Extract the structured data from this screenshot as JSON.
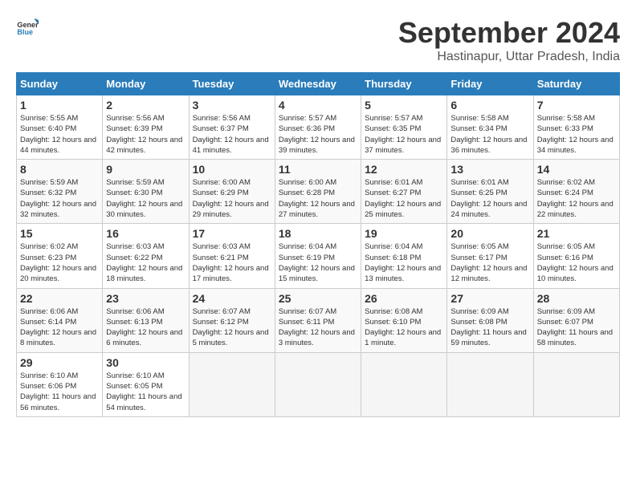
{
  "header": {
    "logo_general": "General",
    "logo_blue": "Blue",
    "month_title": "September 2024",
    "location": "Hastinapur, Uttar Pradesh, India"
  },
  "weekdays": [
    "Sunday",
    "Monday",
    "Tuesday",
    "Wednesday",
    "Thursday",
    "Friday",
    "Saturday"
  ],
  "weeks": [
    [
      {
        "day": "1",
        "sunrise": "5:55 AM",
        "sunset": "6:40 PM",
        "daylight": "12 hours and 44 minutes."
      },
      {
        "day": "2",
        "sunrise": "5:56 AM",
        "sunset": "6:39 PM",
        "daylight": "12 hours and 42 minutes."
      },
      {
        "day": "3",
        "sunrise": "5:56 AM",
        "sunset": "6:37 PM",
        "daylight": "12 hours and 41 minutes."
      },
      {
        "day": "4",
        "sunrise": "5:57 AM",
        "sunset": "6:36 PM",
        "daylight": "12 hours and 39 minutes."
      },
      {
        "day": "5",
        "sunrise": "5:57 AM",
        "sunset": "6:35 PM",
        "daylight": "12 hours and 37 minutes."
      },
      {
        "day": "6",
        "sunrise": "5:58 AM",
        "sunset": "6:34 PM",
        "daylight": "12 hours and 36 minutes."
      },
      {
        "day": "7",
        "sunrise": "5:58 AM",
        "sunset": "6:33 PM",
        "daylight": "12 hours and 34 minutes."
      }
    ],
    [
      {
        "day": "8",
        "sunrise": "5:59 AM",
        "sunset": "6:32 PM",
        "daylight": "12 hours and 32 minutes."
      },
      {
        "day": "9",
        "sunrise": "5:59 AM",
        "sunset": "6:30 PM",
        "daylight": "12 hours and 30 minutes."
      },
      {
        "day": "10",
        "sunrise": "6:00 AM",
        "sunset": "6:29 PM",
        "daylight": "12 hours and 29 minutes."
      },
      {
        "day": "11",
        "sunrise": "6:00 AM",
        "sunset": "6:28 PM",
        "daylight": "12 hours and 27 minutes."
      },
      {
        "day": "12",
        "sunrise": "6:01 AM",
        "sunset": "6:27 PM",
        "daylight": "12 hours and 25 minutes."
      },
      {
        "day": "13",
        "sunrise": "6:01 AM",
        "sunset": "6:25 PM",
        "daylight": "12 hours and 24 minutes."
      },
      {
        "day": "14",
        "sunrise": "6:02 AM",
        "sunset": "6:24 PM",
        "daylight": "12 hours and 22 minutes."
      }
    ],
    [
      {
        "day": "15",
        "sunrise": "6:02 AM",
        "sunset": "6:23 PM",
        "daylight": "12 hours and 20 minutes."
      },
      {
        "day": "16",
        "sunrise": "6:03 AM",
        "sunset": "6:22 PM",
        "daylight": "12 hours and 18 minutes."
      },
      {
        "day": "17",
        "sunrise": "6:03 AM",
        "sunset": "6:21 PM",
        "daylight": "12 hours and 17 minutes."
      },
      {
        "day": "18",
        "sunrise": "6:04 AM",
        "sunset": "6:19 PM",
        "daylight": "12 hours and 15 minutes."
      },
      {
        "day": "19",
        "sunrise": "6:04 AM",
        "sunset": "6:18 PM",
        "daylight": "12 hours and 13 minutes."
      },
      {
        "day": "20",
        "sunrise": "6:05 AM",
        "sunset": "6:17 PM",
        "daylight": "12 hours and 12 minutes."
      },
      {
        "day": "21",
        "sunrise": "6:05 AM",
        "sunset": "6:16 PM",
        "daylight": "12 hours and 10 minutes."
      }
    ],
    [
      {
        "day": "22",
        "sunrise": "6:06 AM",
        "sunset": "6:14 PM",
        "daylight": "12 hours and 8 minutes."
      },
      {
        "day": "23",
        "sunrise": "6:06 AM",
        "sunset": "6:13 PM",
        "daylight": "12 hours and 6 minutes."
      },
      {
        "day": "24",
        "sunrise": "6:07 AM",
        "sunset": "6:12 PM",
        "daylight": "12 hours and 5 minutes."
      },
      {
        "day": "25",
        "sunrise": "6:07 AM",
        "sunset": "6:11 PM",
        "daylight": "12 hours and 3 minutes."
      },
      {
        "day": "26",
        "sunrise": "6:08 AM",
        "sunset": "6:10 PM",
        "daylight": "12 hours and 1 minute."
      },
      {
        "day": "27",
        "sunrise": "6:09 AM",
        "sunset": "6:08 PM",
        "daylight": "11 hours and 59 minutes."
      },
      {
        "day": "28",
        "sunrise": "6:09 AM",
        "sunset": "6:07 PM",
        "daylight": "11 hours and 58 minutes."
      }
    ],
    [
      {
        "day": "29",
        "sunrise": "6:10 AM",
        "sunset": "6:06 PM",
        "daylight": "11 hours and 56 minutes."
      },
      {
        "day": "30",
        "sunrise": "6:10 AM",
        "sunset": "6:05 PM",
        "daylight": "11 hours and 54 minutes."
      },
      null,
      null,
      null,
      null,
      null
    ]
  ]
}
